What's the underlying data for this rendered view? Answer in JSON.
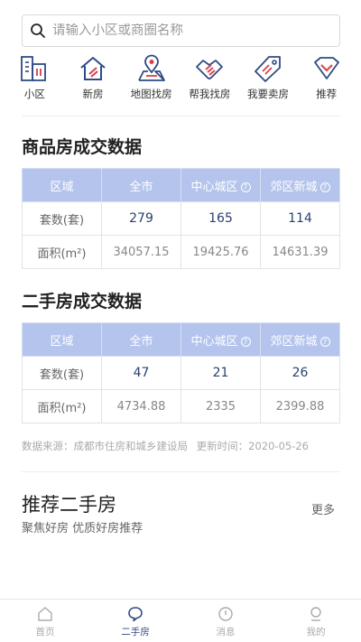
{
  "search": {
    "placeholder": "请输入小区或商圈名称"
  },
  "categories": [
    {
      "label": "小区",
      "icon": "building-icon"
    },
    {
      "label": "新房",
      "icon": "house-icon"
    },
    {
      "label": "地图找房",
      "icon": "map-pin-icon"
    },
    {
      "label": "帮我找房",
      "icon": "handshake-icon"
    },
    {
      "label": "我要卖房",
      "icon": "price-tag-icon"
    },
    {
      "label": "推荐",
      "icon": "heart-check-icon"
    }
  ],
  "new_house": {
    "title": "商品房成交数据",
    "headers": [
      "区域",
      "全市",
      "中心城区",
      "郊区新城"
    ],
    "rows": [
      {
        "label": "套数(套)",
        "values": [
          "279",
          "165",
          "114"
        ]
      },
      {
        "label": "面积(m²)",
        "values": [
          "34057.15",
          "19425.76",
          "14631.39"
        ]
      }
    ]
  },
  "second_house": {
    "title": "二手房成交数据",
    "headers": [
      "区域",
      "全市",
      "中心城区",
      "郊区新城"
    ],
    "rows": [
      {
        "label": "套数(套)",
        "values": [
          "47",
          "21",
          "26"
        ]
      },
      {
        "label": "面积(m²)",
        "values": [
          "4734.88",
          "2335",
          "2399.88"
        ]
      }
    ]
  },
  "source": {
    "text": "数据来源：成都市住房和城乡建设局",
    "update_label": "更新时间：",
    "update_date": "2020-05-26"
  },
  "recommend": {
    "title": "推荐二手房",
    "subtitle": "聚焦好房 优质好房推荐",
    "more": "更多"
  },
  "tabs": [
    {
      "label": "首页",
      "icon": "home-icon",
      "active": false
    },
    {
      "label": "二手房",
      "icon": "chat-bubble-icon",
      "active": true
    },
    {
      "label": "消息",
      "icon": "message-icon",
      "active": false
    },
    {
      "label": "我的",
      "icon": "profile-icon",
      "active": false
    }
  ],
  "colors": {
    "accent": "#2f4a85",
    "header_bg": "#b4c4ec",
    "icon_red": "#d6404a"
  }
}
